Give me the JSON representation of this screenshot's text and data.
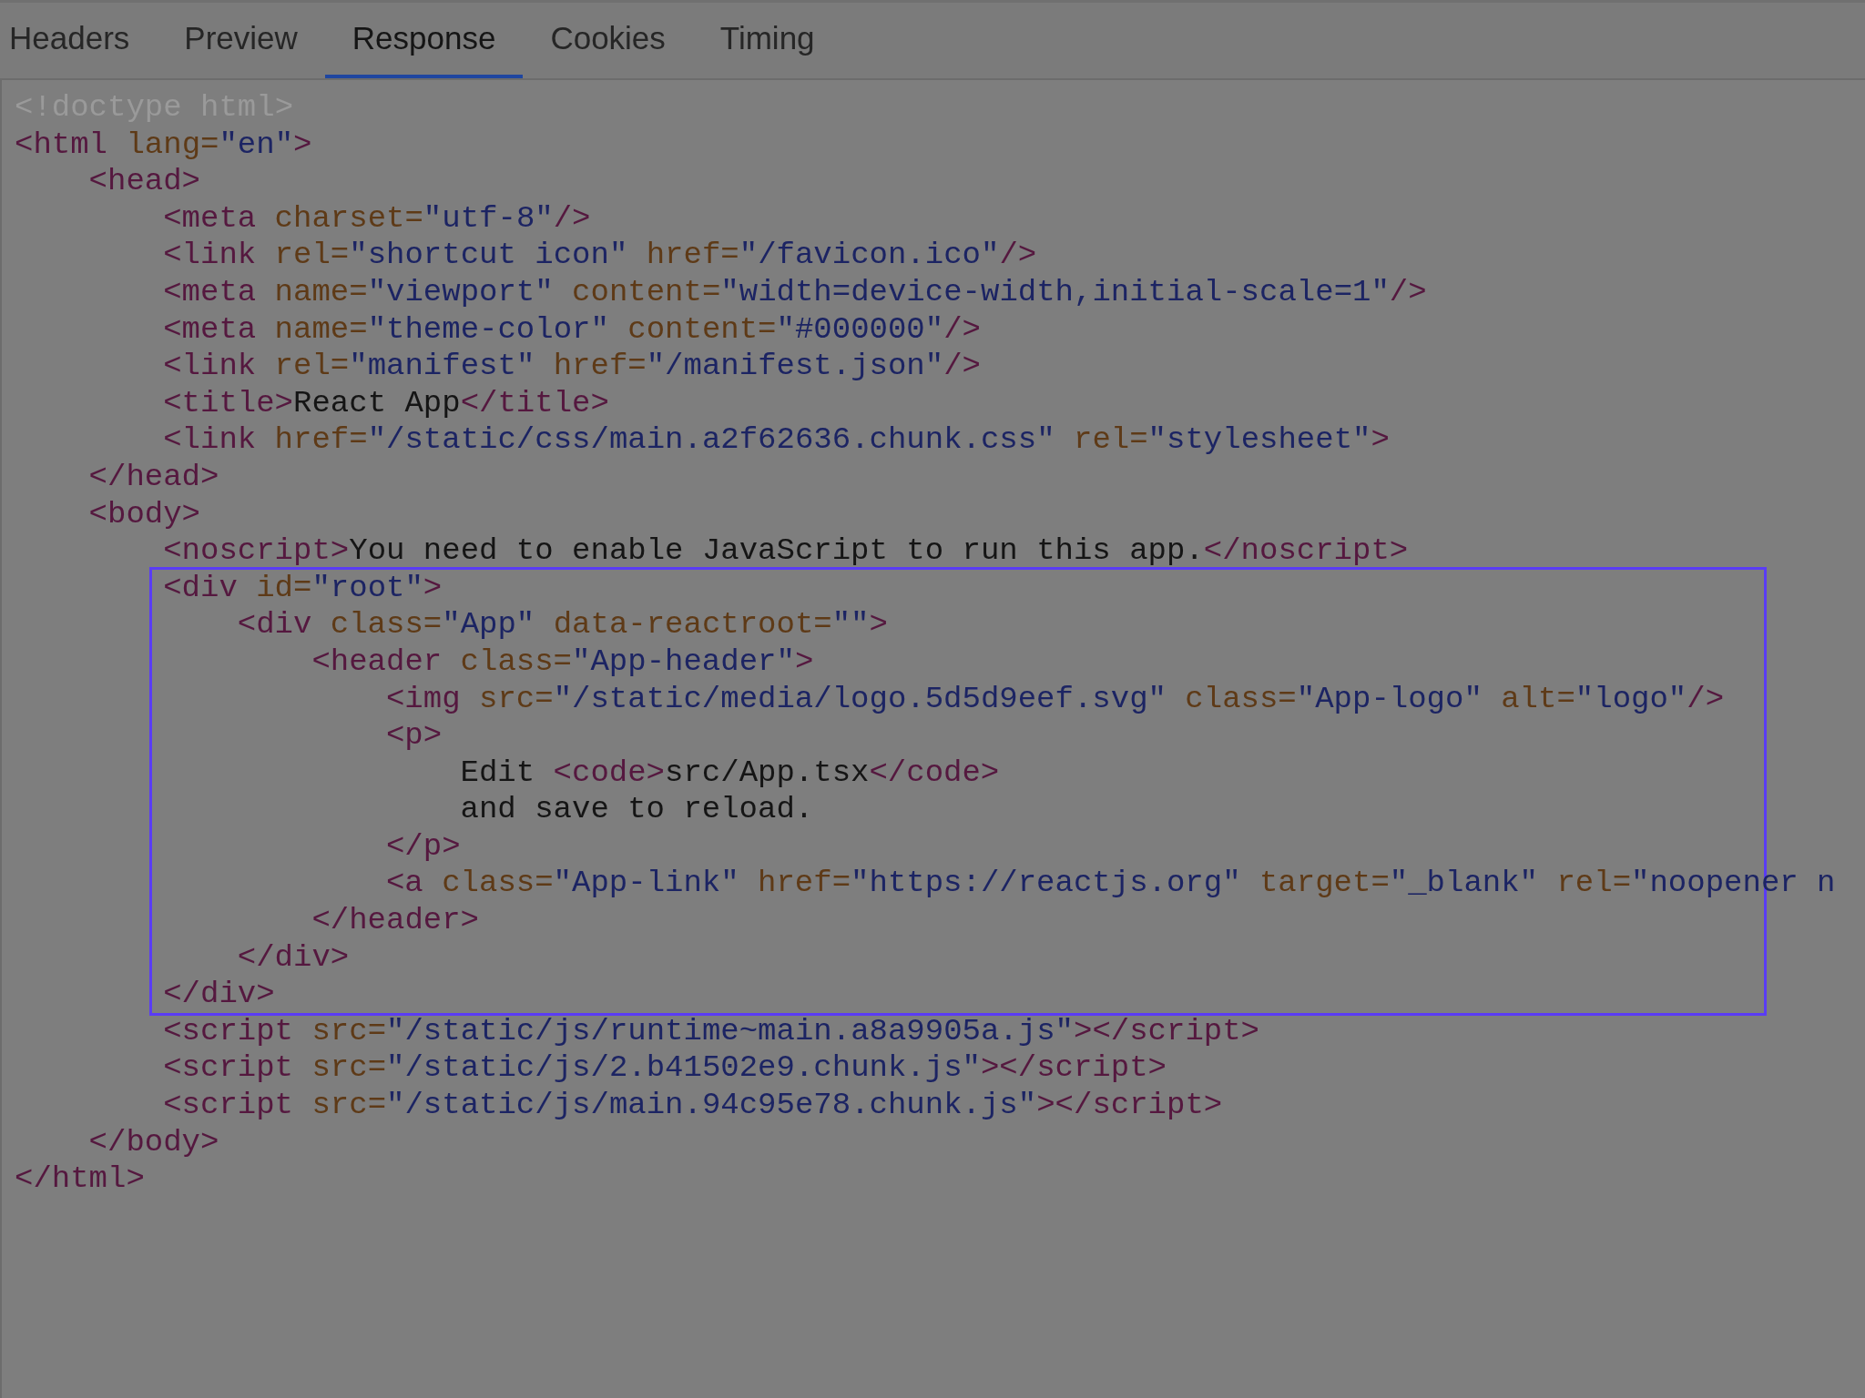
{
  "tabs": [
    {
      "label": "Headers",
      "selected": false
    },
    {
      "label": "Preview",
      "selected": false
    },
    {
      "label": "Response",
      "selected": true
    },
    {
      "label": "Cookies",
      "selected": false
    },
    {
      "label": "Timing",
      "selected": false
    }
  ],
  "response": [
    {
      "tokens": [
        {
          "kind": "doctype",
          "text": "<!doctype html>"
        }
      ]
    },
    {
      "tokens": [
        {
          "kind": "tag",
          "text": "<html"
        },
        {
          "kind": "attr",
          "text": " lang="
        },
        {
          "kind": "value",
          "text": "\"en\""
        },
        {
          "kind": "tag",
          "text": ">"
        }
      ],
      "children": [
        {
          "tokens": [
            {
              "kind": "tag",
              "text": "<head>"
            }
          ],
          "children": [
            {
              "tokens": [
                {
                  "kind": "tag",
                  "text": "<meta"
                },
                {
                  "kind": "attr",
                  "text": " charset="
                },
                {
                  "kind": "value",
                  "text": "\"utf-8\""
                },
                {
                  "kind": "tag",
                  "text": "/>"
                }
              ]
            },
            {
              "tokens": [
                {
                  "kind": "tag",
                  "text": "<link"
                },
                {
                  "kind": "attr",
                  "text": " rel="
                },
                {
                  "kind": "value",
                  "text": "\"shortcut icon\""
                },
                {
                  "kind": "attr",
                  "text": " href="
                },
                {
                  "kind": "value",
                  "text": "\"/favicon.ico\""
                },
                {
                  "kind": "tag",
                  "text": "/>"
                }
              ]
            },
            {
              "tokens": [
                {
                  "kind": "tag",
                  "text": "<meta"
                },
                {
                  "kind": "attr",
                  "text": " name="
                },
                {
                  "kind": "value",
                  "text": "\"viewport\""
                },
                {
                  "kind": "attr",
                  "text": " content="
                },
                {
                  "kind": "value",
                  "text": "\"width=device-width,initial-scale=1\""
                },
                {
                  "kind": "tag",
                  "text": "/>"
                }
              ]
            },
            {
              "tokens": [
                {
                  "kind": "tag",
                  "text": "<meta"
                },
                {
                  "kind": "attr",
                  "text": " name="
                },
                {
                  "kind": "value",
                  "text": "\"theme-color\""
                },
                {
                  "kind": "attr",
                  "text": " content="
                },
                {
                  "kind": "value",
                  "text": "\"#000000\""
                },
                {
                  "kind": "tag",
                  "text": "/>"
                }
              ]
            },
            {
              "tokens": [
                {
                  "kind": "tag",
                  "text": "<link"
                },
                {
                  "kind": "attr",
                  "text": " rel="
                },
                {
                  "kind": "value",
                  "text": "\"manifest\""
                },
                {
                  "kind": "attr",
                  "text": " href="
                },
                {
                  "kind": "value",
                  "text": "\"/manifest.json\""
                },
                {
                  "kind": "tag",
                  "text": "/>"
                }
              ]
            },
            {
              "tokens": [
                {
                  "kind": "tag",
                  "text": "<title>"
                },
                {
                  "kind": "text",
                  "text": "React App"
                },
                {
                  "kind": "tag",
                  "text": "</title>"
                }
              ]
            },
            {
              "tokens": [
                {
                  "kind": "tag",
                  "text": "<link"
                },
                {
                  "kind": "attr",
                  "text": " href="
                },
                {
                  "kind": "value",
                  "text": "\"/static/css/main.a2f62636.chunk.css\""
                },
                {
                  "kind": "attr",
                  "text": " rel="
                },
                {
                  "kind": "value",
                  "text": "\"stylesheet\""
                },
                {
                  "kind": "tag",
                  "text": ">"
                }
              ]
            }
          ]
        },
        {
          "tokens": [
            {
              "kind": "tag",
              "text": "</head>"
            }
          ]
        },
        {
          "tokens": [
            {
              "kind": "tag",
              "text": "<body>"
            }
          ],
          "children": [
            {
              "highlighted": false,
              "tokens": [
                {
                  "kind": "tag",
                  "text": "<noscript>"
                },
                {
                  "kind": "text",
                  "text": "You need to enable JavaScript to run this app."
                },
                {
                  "kind": "tag",
                  "text": "</noscript>"
                }
              ]
            },
            {
              "highlighted": true,
              "tokens": [
                {
                  "kind": "tag",
                  "text": "<div"
                },
                {
                  "kind": "attr",
                  "text": " id="
                },
                {
                  "kind": "value",
                  "text": "\"root\""
                },
                {
                  "kind": "tag",
                  "text": ">"
                }
              ],
              "children": [
                {
                  "tokens": [
                    {
                      "kind": "tag",
                      "text": "<div"
                    },
                    {
                      "kind": "attr",
                      "text": " class="
                    },
                    {
                      "kind": "value",
                      "text": "\"App\""
                    },
                    {
                      "kind": "attr",
                      "text": " data-reactroot="
                    },
                    {
                      "kind": "value",
                      "text": "\"\""
                    },
                    {
                      "kind": "tag",
                      "text": ">"
                    }
                  ],
                  "children": [
                    {
                      "tokens": [
                        {
                          "kind": "tag",
                          "text": "<header"
                        },
                        {
                          "kind": "attr",
                          "text": " class="
                        },
                        {
                          "kind": "value",
                          "text": "\"App-header\""
                        },
                        {
                          "kind": "tag",
                          "text": ">"
                        }
                      ],
                      "children": [
                        {
                          "tokens": [
                            {
                              "kind": "tag",
                              "text": "<img"
                            },
                            {
                              "kind": "attr",
                              "text": " src="
                            },
                            {
                              "kind": "value",
                              "text": "\"/static/media/logo.5d5d9eef.svg\""
                            },
                            {
                              "kind": "attr",
                              "text": " class="
                            },
                            {
                              "kind": "value",
                              "text": "\"App-logo\""
                            },
                            {
                              "kind": "attr",
                              "text": " alt="
                            },
                            {
                              "kind": "value",
                              "text": "\"logo\""
                            },
                            {
                              "kind": "tag",
                              "text": "/>"
                            }
                          ]
                        },
                        {
                          "tokens": [
                            {
                              "kind": "tag",
                              "text": "<p>"
                            }
                          ],
                          "children": [
                            {
                              "tokens": [
                                {
                                  "kind": "text",
                                  "text": "Edit "
                                },
                                {
                                  "kind": "tag",
                                  "text": "<code>"
                                },
                                {
                                  "kind": "text",
                                  "text": "src/App.tsx"
                                },
                                {
                                  "kind": "tag",
                                  "text": "</code>"
                                }
                              ]
                            },
                            {
                              "tokens": [
                                {
                                  "kind": "text",
                                  "text": "and save to reload."
                                }
                              ]
                            }
                          ]
                        },
                        {
                          "tokens": [
                            {
                              "kind": "tag",
                              "text": "</p>"
                            }
                          ]
                        },
                        {
                          "tokens": [
                            {
                              "kind": "tag",
                              "text": "<a"
                            },
                            {
                              "kind": "attr",
                              "text": " class="
                            },
                            {
                              "kind": "value",
                              "text": "\"App-link\""
                            },
                            {
                              "kind": "attr",
                              "text": " href="
                            },
                            {
                              "kind": "value",
                              "text": "\"https://reactjs.org\""
                            },
                            {
                              "kind": "attr",
                              "text": " target="
                            },
                            {
                              "kind": "value",
                              "text": "\"_blank\""
                            },
                            {
                              "kind": "attr",
                              "text": " rel="
                            },
                            {
                              "kind": "value",
                              "text": "\"noopener n"
                            }
                          ]
                        }
                      ]
                    },
                    {
                      "tokens": [
                        {
                          "kind": "tag",
                          "text": "</header>"
                        }
                      ]
                    }
                  ]
                },
                {
                  "tokens": [
                    {
                      "kind": "tag",
                      "text": "</div>"
                    }
                  ]
                }
              ]
            },
            {
              "highlighted": true,
              "tokens": [
                {
                  "kind": "tag",
                  "text": "</div>"
                }
              ]
            },
            {
              "highlighted": false,
              "tokens": [
                {
                  "kind": "tag",
                  "text": "<script"
                },
                {
                  "kind": "attr",
                  "text": " src="
                },
                {
                  "kind": "value",
                  "text": "\"/static/js/runtime~main.a8a9905a.js\""
                },
                {
                  "kind": "tag",
                  "text": "></script>"
                }
              ]
            },
            {
              "highlighted": false,
              "tokens": [
                {
                  "kind": "tag",
                  "text": "<script"
                },
                {
                  "kind": "attr",
                  "text": " src="
                },
                {
                  "kind": "value",
                  "text": "\"/static/js/2.b41502e9.chunk.js\""
                },
                {
                  "kind": "tag",
                  "text": "></script>"
                }
              ]
            },
            {
              "highlighted": false,
              "tokens": [
                {
                  "kind": "tag",
                  "text": "<script"
                },
                {
                  "kind": "attr",
                  "text": " src="
                },
                {
                  "kind": "value",
                  "text": "\"/static/js/main.94c95e78.chunk.js\""
                },
                {
                  "kind": "tag",
                  "text": "></script>"
                }
              ]
            }
          ]
        },
        {
          "tokens": [
            {
              "kind": "tag",
              "text": "</body>"
            }
          ]
        }
      ]
    },
    {
      "tokens": [
        {
          "kind": "tag",
          "text": "</html>"
        }
      ]
    }
  ]
}
